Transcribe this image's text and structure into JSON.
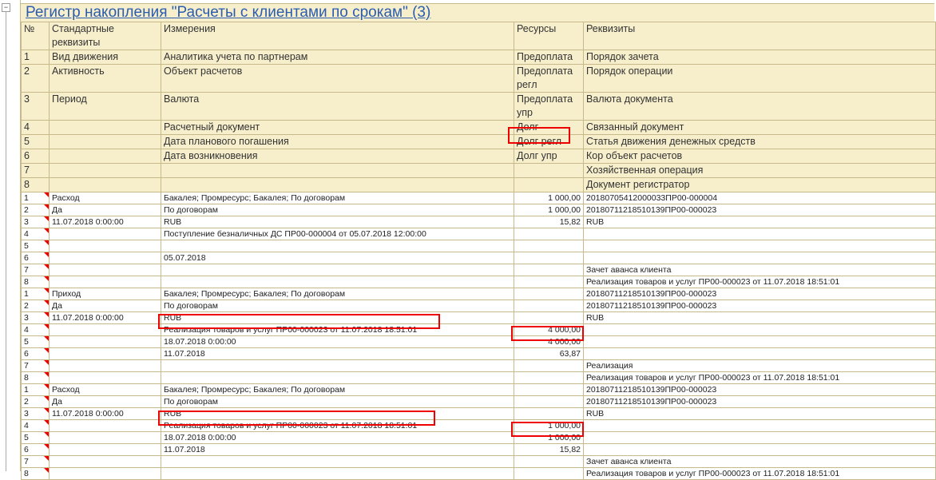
{
  "title": "Регистр накопления \"Расчеты с клиентами по срокам\" (3)",
  "header": {
    "columns": [
      "№",
      "Стандартные реквизиты",
      "Измерения",
      "Ресурсы",
      "Реквизиты"
    ],
    "rows": [
      [
        "1",
        "Вид движения",
        "Аналитика учета по партнерам",
        "Предоплата",
        "Порядок зачета"
      ],
      [
        "2",
        "Активность",
        "Объект расчетов",
        "Предоплата регл",
        "Порядок операции"
      ],
      [
        "3",
        "Период",
        "Валюта",
        "Предоплата упр",
        "Валюта документа"
      ],
      [
        "4",
        "",
        "Расчетный документ",
        "Долг",
        "Связанный документ"
      ],
      [
        "5",
        "",
        "Дата планового погашения",
        "Долг регл",
        "Статья движения денежных средств"
      ],
      [
        "6",
        "",
        "Дата возникновения",
        "Долг упр",
        "Кор объект расчетов"
      ],
      [
        "7",
        "",
        "",
        "",
        "Хозяйственная операция"
      ],
      [
        "8",
        "",
        "",
        "",
        "Документ регистратор"
      ]
    ]
  },
  "records": [
    {
      "movement_color": "red",
      "rows": [
        [
          "1",
          "Расход",
          "Бакалея; Промресурс; Бакалея; По договорам",
          "1 000,00",
          "20180705412000033ПР00-000004"
        ],
        [
          "2",
          "Да",
          "По договорам",
          "1 000,00",
          "20180711218510139ПР00-000023"
        ],
        [
          "3",
          "11.07.2018 0:00:00",
          "RUB",
          "15,82",
          "RUB"
        ],
        [
          "4",
          "",
          "Поступление безналичных ДС ПР00-000004 от 05.07.2018 12:00:00",
          "",
          ""
        ],
        [
          "5",
          "",
          "",
          "",
          ""
        ],
        [
          "6",
          "",
          "05.07.2018",
          "",
          ""
        ],
        [
          "7",
          "",
          "",
          "",
          "Зачет аванса клиента"
        ],
        [
          "8",
          "",
          "",
          "",
          "Реализация товаров и услуг ПР00-000023 от 11.07.2018 18:51:01"
        ]
      ]
    },
    {
      "movement_color": "green",
      "rows": [
        [
          "1",
          "Приход",
          "Бакалея; Промресурс; Бакалея; По договорам",
          "",
          "20180711218510139ПР00-000023"
        ],
        [
          "2",
          "Да",
          "По договорам",
          "",
          "20180711218510139ПР00-000023"
        ],
        [
          "3",
          "11.07.2018 0:00:00",
          "RUB",
          "",
          "RUB"
        ],
        [
          "4",
          "",
          "Реализация товаров и услуг ПР00-000023 от 11.07.2018 18:51:01",
          "4 000,00",
          ""
        ],
        [
          "5",
          "",
          "18.07.2018 0:00:00",
          "4 000,00",
          ""
        ],
        [
          "6",
          "",
          "11.07.2018",
          "63,87",
          ""
        ],
        [
          "7",
          "",
          "",
          "",
          "Реализация"
        ],
        [
          "8",
          "",
          "",
          "",
          "Реализация товаров и услуг ПР00-000023 от 11.07.2018 18:51:01"
        ]
      ]
    },
    {
      "movement_color": "red",
      "rows": [
        [
          "1",
          "Расход",
          "Бакалея; Промресурс; Бакалея; По договорам",
          "",
          "20180711218510139ПР00-000023"
        ],
        [
          "2",
          "Да",
          "По договорам",
          "",
          "20180711218510139ПР00-000023"
        ],
        [
          "3",
          "11.07.2018 0:00:00",
          "RUB",
          "",
          "RUB"
        ],
        [
          "4",
          "",
          "Реализация товаров и услуг ПР00-000023 от 11.07.2018 18:51:01",
          "1 000,00",
          ""
        ],
        [
          "5",
          "",
          "18.07.2018 0:00:00",
          "1 000,00",
          ""
        ],
        [
          "6",
          "",
          "11.07.2018",
          "15,82",
          ""
        ],
        [
          "7",
          "",
          "",
          "",
          "Зачет аванса клиента"
        ],
        [
          "8",
          "",
          "",
          "",
          "Реализация товаров и услуг ПР00-000023 от 11.07.2018 18:51:01"
        ]
      ]
    }
  ],
  "colors": {
    "header_bg": "#f7efcc",
    "border": "#c8b98a",
    "title": "#2a5cb0",
    "highlight": "#e00000"
  }
}
